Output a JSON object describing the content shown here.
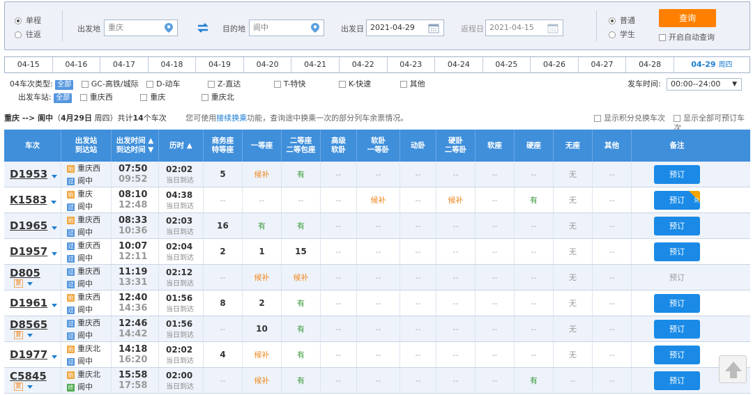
{
  "search": {
    "trip_types": [
      "单程",
      "往返"
    ],
    "from_label": "出发地",
    "from_value": "重庆",
    "to_label": "目的地",
    "to_value": "阆中",
    "depart_label": "出发日",
    "depart_value": "2021-04-29",
    "return_label": "返程日",
    "return_value": "2021-04-15",
    "passenger_types": [
      "普通",
      "学生"
    ],
    "query_label": "查询",
    "auto_query_label": "开启自动查询"
  },
  "dates": [
    "04-15",
    "04-16",
    "04-17",
    "04-18",
    "04-19",
    "04-20",
    "04-21",
    "04-22",
    "04-23",
    "04-24",
    "04-25",
    "04-26",
    "04-27",
    "04-28"
  ],
  "active_date": "04-29",
  "active_weekday": "周四",
  "filters": {
    "type_label": "04车次类型:",
    "all_label": "全部",
    "types": [
      "GC-高铁/城际",
      "D-动车",
      "Z-直达",
      "T-特快",
      "K-快速",
      "其他"
    ],
    "station_label": "出发车站:",
    "stations": [
      "重庆西",
      "重庆",
      "重庆北"
    ],
    "time_label": "发车时间:",
    "time_value": "00:00--24:00"
  },
  "info": {
    "route": "重庆 --> 阆中",
    "date_open": "（",
    "date_text": "4月29日",
    "date_weekday": " 周四",
    "date_close": "）",
    "total_pre": "共计",
    "total_count": "14",
    "total_post": "个车次",
    "tip_pre": "您可使用",
    "tip_link": "接续换乘",
    "tip_post": "功能，查询途中换乘一次的部分列车余票情况。",
    "opt1": "显示积分兑换车次",
    "opt2": "显示全部可预订车次"
  },
  "columns": [
    {
      "key": "train",
      "label": "车次"
    },
    {
      "key": "stations",
      "label": "出发站\n到达站"
    },
    {
      "key": "times",
      "label": "出发时间 ▲\n到达时间 ▼"
    },
    {
      "key": "dur",
      "label": "历时 ▲"
    },
    {
      "key": "swz",
      "label": "商务座\n特等座"
    },
    {
      "key": "ydz",
      "label": "一等座"
    },
    {
      "key": "edz",
      "label": "二等座\n二等包座"
    },
    {
      "key": "gjrw",
      "label": "高级\n软卧"
    },
    {
      "key": "rw",
      "label": "软卧\n一等卧"
    },
    {
      "key": "dw",
      "label": "动卧"
    },
    {
      "key": "yw",
      "label": "硬卧\n二等卧"
    },
    {
      "key": "rz",
      "label": "软座"
    },
    {
      "key": "yz",
      "label": "硬座"
    },
    {
      "key": "wz",
      "label": "无座"
    },
    {
      "key": "qt",
      "label": "其他"
    },
    {
      "key": "note",
      "label": "备注"
    }
  ],
  "trains": [
    {
      "no": "D1953",
      "fu": "",
      "from_tag": "始",
      "from": "重庆西",
      "to_tag": "过",
      "to": "阆中",
      "dep": "07:50",
      "arr": "09:52",
      "dur": "02:02",
      "arrive": "当日到达",
      "seats": [
        "5",
        "候补",
        "有",
        "--",
        "--",
        "--",
        "--",
        "--",
        "--",
        "无",
        "--"
      ],
      "book": "预订",
      "book_enabled": true,
      "badge": ""
    },
    {
      "no": "K1583",
      "fu": "",
      "from_tag": "始",
      "from": "重庆",
      "to_tag": "过",
      "to": "阆中",
      "dep": "08:10",
      "arr": "12:48",
      "dur": "04:38",
      "arrive": "当日到达",
      "seats": [
        "--",
        "--",
        "--",
        "--",
        "候补",
        "--",
        "候补",
        "--",
        "有",
        "无",
        "--"
      ],
      "book": "预订",
      "book_enabled": true,
      "badge": "兑"
    },
    {
      "no": "D1965",
      "fu": "",
      "from_tag": "始",
      "from": "重庆西",
      "to_tag": "过",
      "to": "阆中",
      "dep": "08:33",
      "arr": "10:36",
      "dur": "02:03",
      "arrive": "当日到达",
      "seats": [
        "16",
        "有",
        "有",
        "--",
        "--",
        "--",
        "--",
        "--",
        "--",
        "无",
        "--"
      ],
      "book": "预订",
      "book_enabled": true,
      "badge": ""
    },
    {
      "no": "D1957",
      "fu": "",
      "from_tag": "过",
      "from": "重庆西",
      "to_tag": "过",
      "to": "阆中",
      "dep": "10:07",
      "arr": "12:11",
      "dur": "02:04",
      "arrive": "当日到达",
      "seats": [
        "2",
        "1",
        "15",
        "--",
        "--",
        "--",
        "--",
        "--",
        "--",
        "无",
        "--"
      ],
      "book": "预订",
      "book_enabled": true,
      "badge": ""
    },
    {
      "no": "D805",
      "fu": "复",
      "from_tag": "过",
      "from": "重庆西",
      "to_tag": "过",
      "to": "阆中",
      "dep": "11:19",
      "arr": "13:31",
      "dur": "02:12",
      "arrive": "当日到达",
      "seats": [
        "--",
        "候补",
        "候补",
        "--",
        "--",
        "--",
        "--",
        "--",
        "--",
        "无",
        "--"
      ],
      "book": "预订",
      "book_enabled": false,
      "badge": ""
    },
    {
      "no": "D1961",
      "fu": "",
      "from_tag": "始",
      "from": "重庆西",
      "to_tag": "过",
      "to": "阆中",
      "dep": "12:40",
      "arr": "14:36",
      "dur": "01:56",
      "arrive": "当日到达",
      "seats": [
        "8",
        "2",
        "有",
        "--",
        "--",
        "--",
        "--",
        "--",
        "--",
        "无",
        "--"
      ],
      "book": "预订",
      "book_enabled": true,
      "badge": ""
    },
    {
      "no": "D8565",
      "fu": "复",
      "from_tag": "过",
      "from": "重庆西",
      "to_tag": "过",
      "to": "阆中",
      "dep": "12:46",
      "arr": "14:42",
      "dur": "01:56",
      "arrive": "当日到达",
      "seats": [
        "--",
        "10",
        "有",
        "--",
        "--",
        "--",
        "--",
        "--",
        "--",
        "无",
        "--"
      ],
      "book": "预订",
      "book_enabled": true,
      "badge": ""
    },
    {
      "no": "D1977",
      "fu": "",
      "from_tag": "始",
      "from": "重庆北",
      "to_tag": "过",
      "to": "阆中",
      "dep": "14:18",
      "arr": "16:20",
      "dur": "02:02",
      "arrive": "当日到达",
      "seats": [
        "4",
        "候补",
        "有",
        "--",
        "--",
        "--",
        "--",
        "--",
        "--",
        "无",
        "--"
      ],
      "book": "预订",
      "book_enabled": true,
      "badge": ""
    },
    {
      "no": "C5845",
      "fu": "复",
      "from_tag": "始",
      "from": "重庆北",
      "to_tag": "终",
      "to": "阆中",
      "dep": "15:58",
      "arr": "17:58",
      "dur": "02:00",
      "arrive": "当日到达",
      "seats": [
        "--",
        "候补",
        "有",
        "--",
        "--",
        "--",
        "--",
        "--",
        "有",
        "--",
        "--"
      ],
      "book": "预订",
      "book_enabled": true,
      "badge": ""
    }
  ]
}
